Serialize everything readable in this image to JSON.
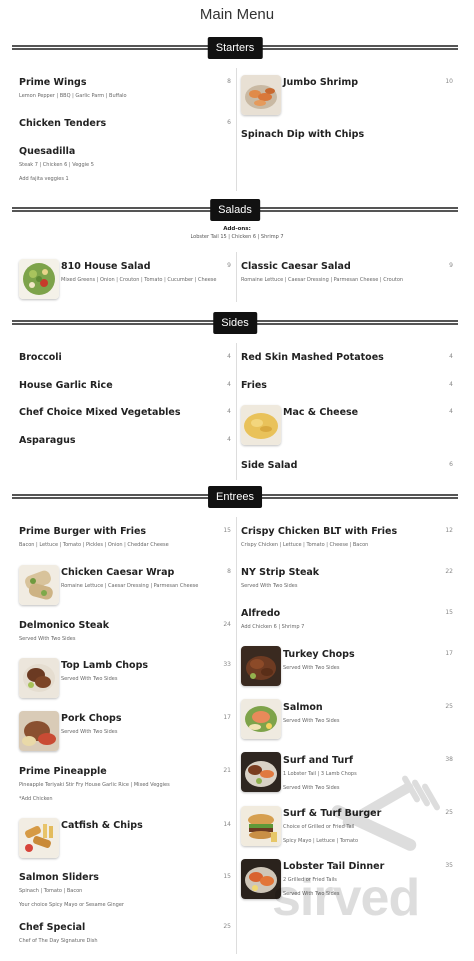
{
  "page": {
    "title": "Main Menu"
  },
  "sections": {
    "starters": "Starters",
    "salads": "Salads",
    "sides": "Sides",
    "entrees": "Entrees"
  },
  "salads_addons": {
    "title": "Add-ons:",
    "values": "Lobster Tail 15 | Chicken 6 | Shrimp 7"
  },
  "starters": {
    "prime_wings": {
      "name": "Prime Wings",
      "price": "8",
      "desc": "Lemon Pepper | BBQ | Garlic Parm | Buffalo"
    },
    "chicken_tenders": {
      "name": "Chicken Tenders",
      "price": "6"
    },
    "quesadilla": {
      "name": "Quesadilla",
      "desc": "Steak 7 | Chicken 6 | Veggie 5",
      "desc2": "Add fajita veggies 1"
    },
    "jumbo_shrimp": {
      "name": "Jumbo Shrimp",
      "price": "10",
      "image": "shrimp-photo"
    },
    "spinach_dip": {
      "name": "Spinach Dip with Chips"
    }
  },
  "salads": {
    "house_salad": {
      "name": "810 House Salad",
      "price": "9",
      "desc": "Mixed Greens | Onion | Crouton | Tomato | Cucumber | Cheese",
      "image": "salad-photo"
    },
    "caesar_salad": {
      "name": "Classic Caesar Salad",
      "price": "9",
      "desc": "Romaine Lettuce | Caesar Dressing | Parmesan Cheese | Crouton"
    }
  },
  "sides": {
    "broccoli": {
      "name": "Broccoli",
      "price": "4"
    },
    "garlic_rice": {
      "name": "House Garlic Rice",
      "price": "4"
    },
    "mixed_veg": {
      "name": "Chef Choice Mixed Vegetables",
      "price": "4"
    },
    "asparagus": {
      "name": "Asparagus",
      "price": "4"
    },
    "mashed_potatoes": {
      "name": "Red Skin Mashed Potatoes",
      "price": "4"
    },
    "fries": {
      "name": "Fries",
      "price": "4"
    },
    "mac_cheese": {
      "name": "Mac & Cheese",
      "price": "4",
      "image": "mac-cheese-photo"
    },
    "side_salad": {
      "name": "Side Salad",
      "price": "6"
    }
  },
  "entrees": {
    "prime_burger": {
      "name": "Prime Burger with Fries",
      "price": "15",
      "desc": "Bacon | Lettuce | Tomato | Pickles | Onion | Cheddar Cheese"
    },
    "caesar_wrap": {
      "name": "Chicken Caesar Wrap",
      "price": "8",
      "desc": "Romaine Lettuce | Caesar Dressing | Parmesan Cheese",
      "image": "wrap-photo"
    },
    "delmonico": {
      "name": "Delmonico Steak",
      "price": "24",
      "desc": "Served With Two Sides"
    },
    "lamb_chops": {
      "name": "Top Lamb Chops",
      "price": "33",
      "desc": "Served With Two Sides",
      "image": "lamb-photo"
    },
    "pork_chops": {
      "name": "Pork Chops",
      "price": "17",
      "desc": "Served With Two Sides",
      "image": "pork-photo"
    },
    "prime_pineapple": {
      "name": "Prime Pineapple",
      "price": "21",
      "desc": "Pineapple Teriyaki Stir Fry House Garlic Rice | Mixed Veggies",
      "desc2": "*Add Chicken"
    },
    "catfish": {
      "name": "Catfish & Chips",
      "price": "14",
      "image": "catfish-photo"
    },
    "salmon_sliders": {
      "name": "Salmon Sliders",
      "price": "15",
      "desc": "Spinach | Tomato | Bacon",
      "desc2": "Your choice Spicy Mayo or Sesame Ginger"
    },
    "chef_special": {
      "name": "Chef Special",
      "price": "25",
      "desc": "Chef of The Day Signature Dish"
    },
    "crispy_blt": {
      "name": "Crispy Chicken BLT with Fries",
      "price": "12",
      "desc": "Crispy Chicken | Lettuce | Tomato | Cheese | Bacon"
    },
    "ny_strip": {
      "name": "NY Strip Steak",
      "price": "22",
      "desc": "Served With Two Sides"
    },
    "alfredo": {
      "name": "Alfredo",
      "price": "15",
      "desc": "Add Chicken 6 | Shrimp 7"
    },
    "turkey_chops": {
      "name": "Turkey Chops",
      "price": "17",
      "desc": "Served With Two Sides",
      "image": "turkey-photo"
    },
    "salmon": {
      "name": "Salmon",
      "price": "25",
      "desc": "Served With Two Sides",
      "image": "salmon-photo"
    },
    "surf_turf": {
      "name": "Surf and Turf",
      "price": "38",
      "desc": "1 Lobster Tail | 3 Lamb Chops",
      "desc2": "Served With Two Sides",
      "image": "surf-turf-photo"
    },
    "surf_turf_burger": {
      "name": "Surf & Turf Burger",
      "price": "25",
      "desc": "Choice of Grilled or Fried Tail",
      "desc2": "Spicy Mayo | Lettuce | Tomato",
      "image": "burger-photo"
    },
    "lobster_dinner": {
      "name": "Lobster Tail Dinner",
      "price": "35",
      "desc": "2 Grilled or Fried Tails",
      "desc2": "Served With Two Sides",
      "image": "lobster-photo"
    }
  },
  "watermark": {
    "text": "sirved",
    "icon": "fork-knife-icon"
  }
}
